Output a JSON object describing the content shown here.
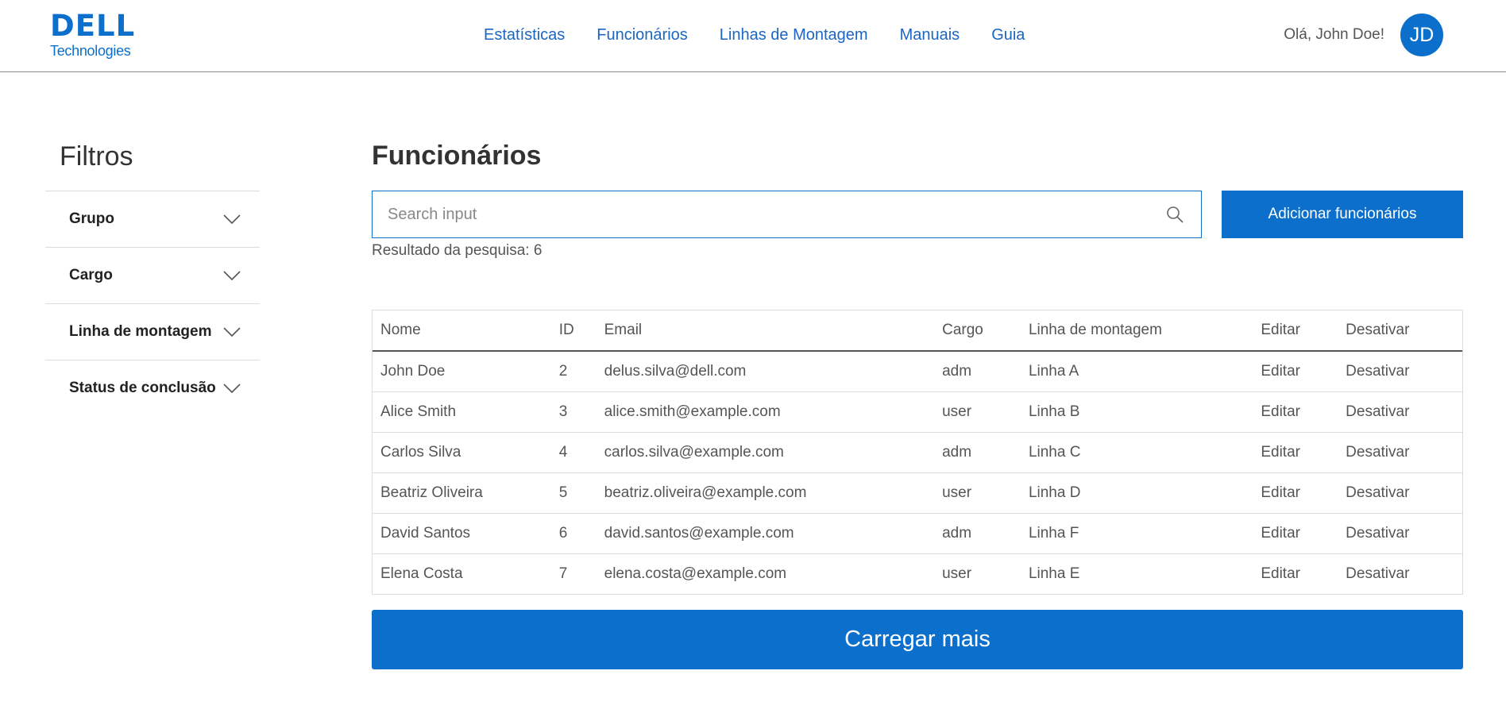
{
  "header": {
    "logo_main": "DELL",
    "logo_sub": "Technologies",
    "nav": [
      "Estatísticas",
      "Funcionários",
      "Linhas de Montagem",
      "Manuais",
      "Guia"
    ],
    "greeting": "Olá, John Doe!",
    "avatar_initials": "JD"
  },
  "sidebar": {
    "title": "Filtros",
    "filters": [
      "Grupo",
      "Cargo",
      "Linha de montagem",
      "Status de conclusão"
    ]
  },
  "main": {
    "title": "Funcionários",
    "search_placeholder": "Search input",
    "add_button": "Adicionar funcionários",
    "result_count": "Resultado da pesquisa: 6",
    "load_more": "Carregar mais"
  },
  "table": {
    "columns": [
      "Nome",
      "ID",
      "Email",
      "Cargo",
      "Linha de montagem",
      "Editar",
      "Desativar"
    ],
    "rows": [
      [
        "John Doe",
        "2",
        "delus.silva@dell.com",
        "adm",
        "Linha A",
        "Editar",
        "Desativar"
      ],
      [
        "Alice Smith",
        "3",
        "alice.smith@example.com",
        "user",
        "Linha B",
        "Editar",
        "Desativar"
      ],
      [
        "Carlos Silva",
        "4",
        "carlos.silva@example.com",
        "adm",
        "Linha C",
        "Editar",
        "Desativar"
      ],
      [
        "Beatriz Oliveira",
        "5",
        "beatriz.oliveira@example.com",
        "user",
        "Linha D",
        "Editar",
        "Desativar"
      ],
      [
        "David Santos",
        "6",
        "david.santos@example.com",
        "adm",
        "Linha F",
        "Editar",
        "Desativar"
      ],
      [
        "Elena Costa",
        "7",
        "elena.costa@example.com",
        "user",
        "Linha E",
        "Editar",
        "Desativar"
      ]
    ]
  },
  "icons": {
    "search": "search-icon",
    "chevron": "chevron-down-icon"
  },
  "colors": {
    "accent": "#0b6fcb",
    "nav_link": "#1a66c2"
  }
}
